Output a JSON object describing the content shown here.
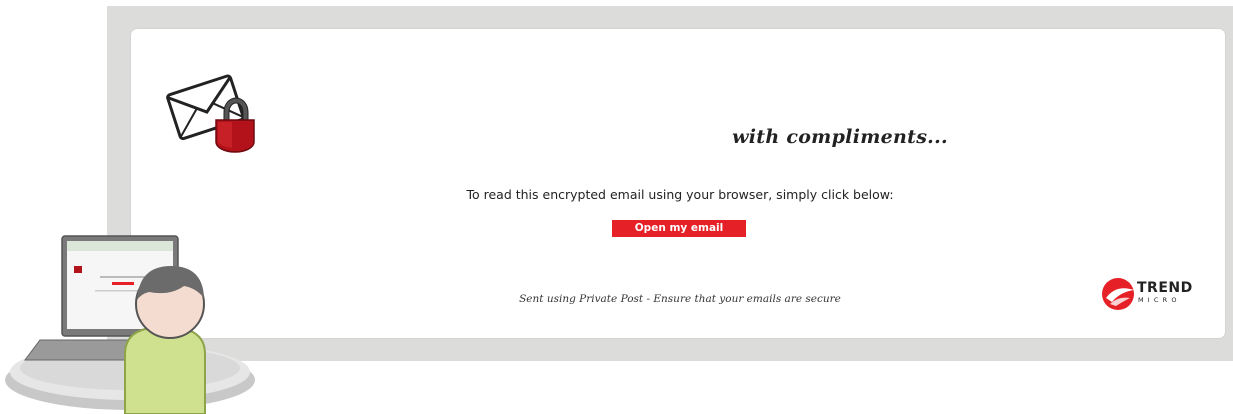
{
  "email": {
    "tagline": "with compliments...",
    "instruction": "To read this encrypted email using your browser, simply click below:",
    "open_button_label": "Open my email",
    "footer": "Sent using Private Post - Ensure that your emails are secure"
  },
  "brand": {
    "name_top": "TREND",
    "name_bottom": "MICRO",
    "accent_color": "#e52127"
  },
  "icons": [
    "envelope-lock-icon",
    "trend-micro-logo",
    "user-laptop-illustration"
  ]
}
